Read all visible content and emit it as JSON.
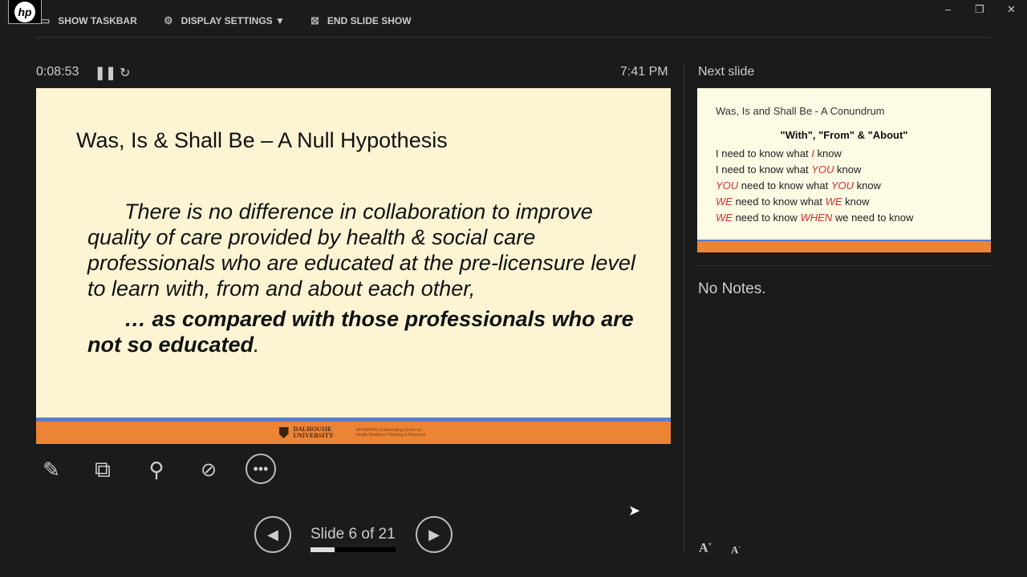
{
  "toolbar": {
    "logo": "hp",
    "show_taskbar": "SHOW TASKBAR",
    "display_settings": "DISPLAY SETTINGS ▼",
    "end_slide_show": "END SLIDE SHOW"
  },
  "window": {
    "minimize": "–",
    "restore": "❐",
    "close": "✕"
  },
  "timer": "0:08:53",
  "clock": "7:41 PM",
  "current_slide": {
    "title": "Was, Is & Shall Be – A Null Hypothesis",
    "paragraph": "There is no difference in collaboration to improve quality of care provided by health & social care professionals who are educated at the pre-licensure level to learn with, from and about each other,",
    "bold_text": "… as compared with those professionals who are not so educated",
    "bold_tail": ".",
    "footer_university": "DALHOUSIE UNIVERSITY",
    "footer_centre": "WHO/PAHO Collaborating Centre on Health Workforce Planning & Research"
  },
  "next_slide": {
    "label": "Next slide",
    "title": "Was, Is and Shall Be  - A Conundrum",
    "heading": "\"With\", \"From\" & \"About\"",
    "lines": [
      [
        {
          "t": "I need to know what "
        },
        {
          "t": "I",
          "r": 1
        },
        {
          "t": " know"
        }
      ],
      [
        {
          "t": "I need to know what "
        },
        {
          "t": "YOU",
          "r": 1
        },
        {
          "t": " know"
        }
      ],
      [
        {
          "t": "YOU",
          "r": 1
        },
        {
          "t": " need to know what "
        },
        {
          "t": "YOU",
          "r": 1
        },
        {
          "t": " know"
        }
      ],
      [
        {
          "t": "WE",
          "r": 1
        },
        {
          "t": " need to know what "
        },
        {
          "t": "WE",
          "r": 1
        },
        {
          "t": " know"
        }
      ],
      [
        {
          "t": "WE",
          "r": 1
        },
        {
          "t": " need to know "
        },
        {
          "t": "WHEN",
          "r": 1
        },
        {
          "t": " we need to know"
        }
      ]
    ]
  },
  "notes": "No Notes.",
  "navigation": {
    "counter": "Slide 6 of 21",
    "progress": 0.286
  },
  "colors": {
    "orange": "#ec8436",
    "blue": "#5b7fc4",
    "red": "#d03030"
  }
}
